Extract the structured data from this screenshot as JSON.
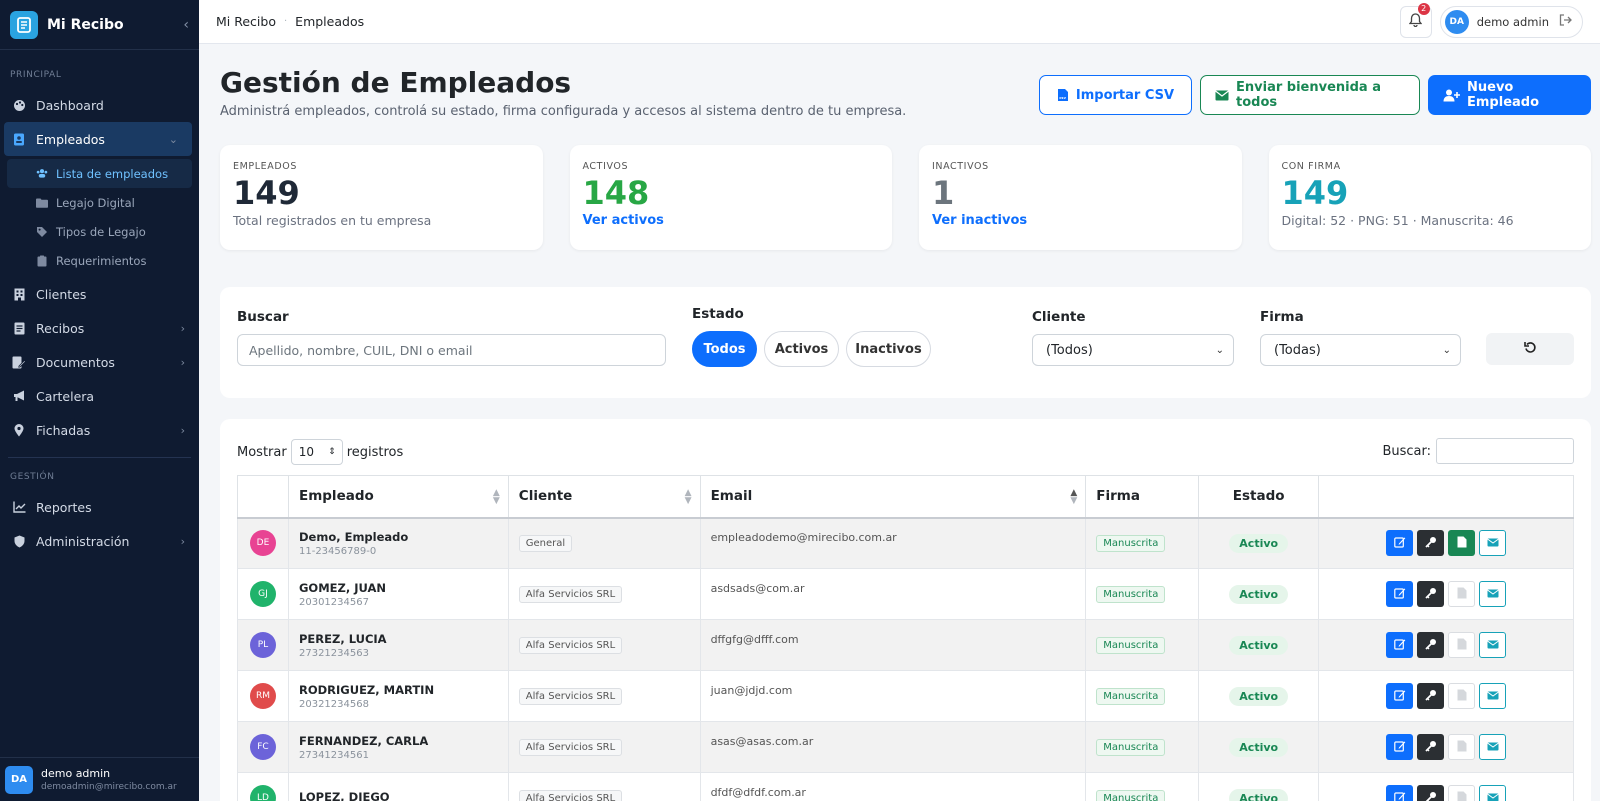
{
  "brand": {
    "name": "Mi Recibo"
  },
  "sidebar": {
    "section_principal": "PRINCIPAL",
    "section_gestion": "GESTIÓN",
    "items": [
      {
        "label": "Dashboard",
        "icon": "palette-icon"
      },
      {
        "label": "Empleados",
        "icon": "id-badge-icon"
      },
      {
        "label": "Clientes",
        "icon": "building-icon"
      },
      {
        "label": "Recibos",
        "icon": "receipt-icon"
      },
      {
        "label": "Documentos",
        "icon": "file-pen-icon"
      },
      {
        "label": "Cartelera",
        "icon": "megaphone-icon"
      },
      {
        "label": "Fichadas",
        "icon": "location-pin-icon"
      },
      {
        "label": "Reportes",
        "icon": "chart-line-icon"
      },
      {
        "label": "Administración",
        "icon": "shield-icon"
      }
    ],
    "subitems": [
      {
        "label": "Lista de empleados"
      },
      {
        "label": "Legajo Digital"
      },
      {
        "label": "Tipos de Legajo"
      },
      {
        "label": "Requerimientos"
      }
    ],
    "user": {
      "initials": "DA",
      "name": "demo admin",
      "email": "demoadmin@mirecibo.com.ar"
    }
  },
  "topbar": {
    "crumb_home": "Mi Recibo",
    "crumb_current": "Empleados",
    "notifications": "2",
    "user_initials": "DA",
    "user_name": "demo admin"
  },
  "header": {
    "title": "Gestión de Empleados",
    "subtitle": "Administrá empleados, controlá su estado, firma configurada y accesos al sistema dentro de tu empresa.",
    "btn_csv": "Importar CSV",
    "btn_welcome": "Enviar bienvenida a todos",
    "btn_new": "Nuevo Empleado"
  },
  "stats": [
    {
      "label": "EMPLEADOS",
      "value": "149",
      "note": "Total registrados en tu empresa",
      "color": "#1f2937"
    },
    {
      "label": "ACTIVOS",
      "value": "148",
      "note": "Ver activos",
      "color": "#28a745"
    },
    {
      "label": "INACTIVOS",
      "value": "1",
      "note": "Ver inactivos",
      "color": "#6c757d"
    },
    {
      "label": "CON FIRMA",
      "value": "149",
      "note": "Digital: 52 · PNG: 51 · Manuscrita: 46",
      "color": "#17a2b8"
    }
  ],
  "filters": {
    "search_label": "Buscar",
    "search_placeholder": "Apellido, nombre, CUIL, DNI o email",
    "estado_label": "Estado",
    "estado_options": [
      "Todos",
      "Activos",
      "Inactivos"
    ],
    "cliente_label": "Cliente",
    "cliente_value": "(Todos)",
    "firma_label": "Firma",
    "firma_value": "(Todas)"
  },
  "table": {
    "show_label": "Mostrar",
    "show_value": "10",
    "show_suffix": "registros",
    "search_label": "Buscar:",
    "columns": [
      "Empleado",
      "Cliente",
      "Email",
      "Firma",
      "Estado"
    ],
    "rows": [
      {
        "initials": "DE",
        "color": "#e84393",
        "name": "Demo, Empleado",
        "id": "11-23456789-0",
        "client": "General",
        "email": "empleadodemo@mirecibo.com.ar",
        "firma": "Manuscrita",
        "estado": "Activo",
        "doc_active": true
      },
      {
        "initials": "GJ",
        "color": "#20b36b",
        "name": "GOMEZ, JUAN",
        "id": "20301234567",
        "client": "Alfa Servicios SRL",
        "email": "asdsads@com.ar",
        "firma": "Manuscrita",
        "estado": "Activo",
        "doc_active": false
      },
      {
        "initials": "PL",
        "color": "#6c63d9",
        "name": "PEREZ, LUCIA",
        "id": "27321234563",
        "client": "Alfa Servicios SRL",
        "email": "dffgfg@dfff.com",
        "firma": "Manuscrita",
        "estado": "Activo",
        "doc_active": false
      },
      {
        "initials": "RM",
        "color": "#e04b4b",
        "name": "RODRIGUEZ, MARTIN",
        "id": "20321234568",
        "client": "Alfa Servicios SRL",
        "email": "juan@jdjd.com",
        "firma": "Manuscrita",
        "estado": "Activo",
        "doc_active": false
      },
      {
        "initials": "FC",
        "color": "#6c63d9",
        "name": "FERNANDEZ, CARLA",
        "id": "27341234561",
        "client": "Alfa Servicios SRL",
        "email": "asas@asas.com.ar",
        "firma": "Manuscrita",
        "estado": "Activo",
        "doc_active": false
      },
      {
        "initials": "LD",
        "color": "#20b36b",
        "name": "LOPEZ, DIEGO",
        "id": "",
        "client": "Alfa Servicios SRL",
        "email": "dfdf@dfdf.com.ar",
        "firma": "Manuscrita",
        "estado": "Activo",
        "doc_active": false
      }
    ]
  }
}
